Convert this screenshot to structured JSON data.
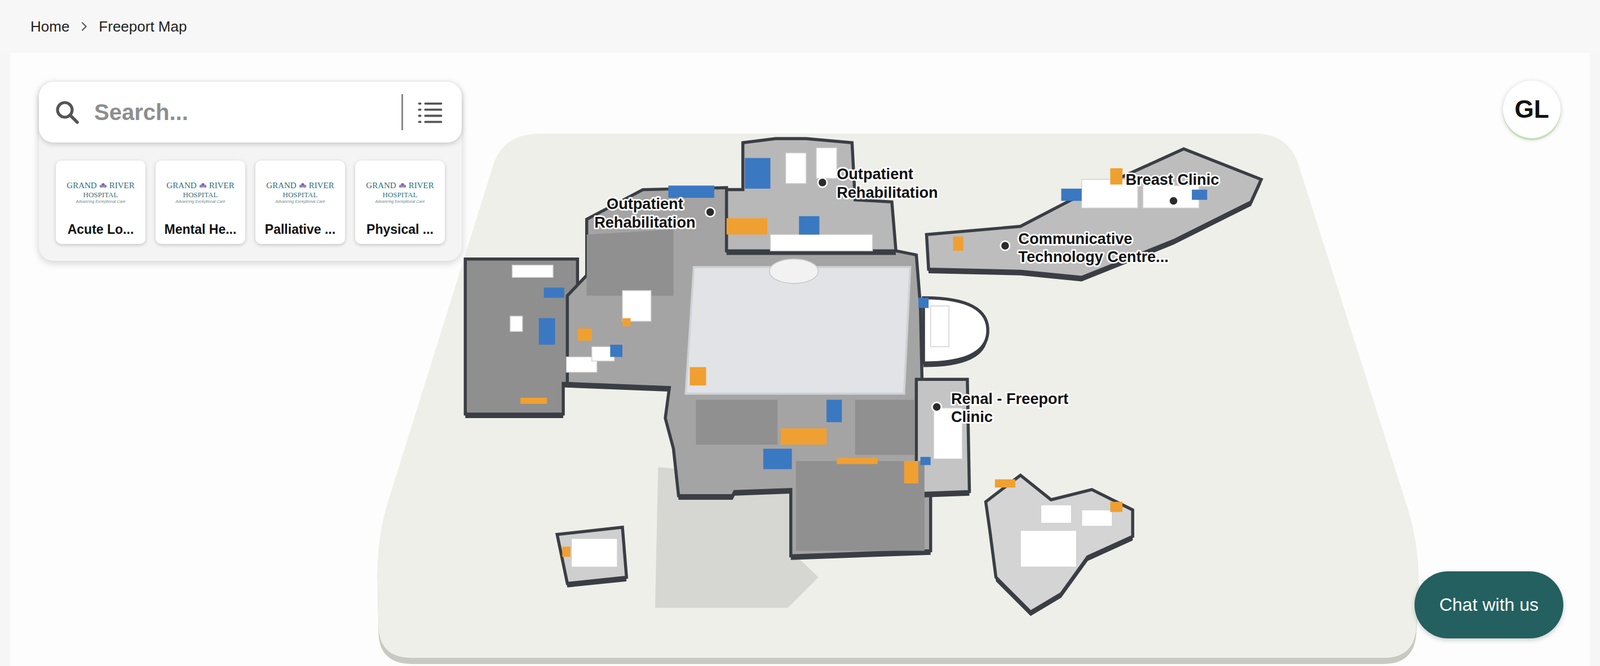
{
  "breadcrumb": {
    "items": [
      {
        "label": "Home"
      },
      {
        "label": "Freeport Map"
      }
    ]
  },
  "search": {
    "placeholder": "Search..."
  },
  "categories": [
    {
      "label": "Acute Lo...",
      "logo": {
        "left": "GRAND",
        "right": "RIVER",
        "sub": "HOSPITAL",
        "tagline": "Advancing Exceptional Care"
      }
    },
    {
      "label": "Mental He...",
      "logo": {
        "left": "GRAND",
        "right": "RIVER",
        "sub": "HOSPITAL",
        "tagline": "Advancing Exceptional Care"
      }
    },
    {
      "label": "Palliative ...",
      "logo": {
        "left": "GRAND",
        "right": "RIVER",
        "sub": "HOSPITAL",
        "tagline": "Advancing Exceptional Care"
      }
    },
    {
      "label": "Physical ...",
      "logo": {
        "left": "GRAND",
        "right": "RIVER",
        "sub": "HOSPITAL",
        "tagline": "Advancing Exceptional Care"
      }
    }
  ],
  "user": {
    "initials": "GL"
  },
  "map": {
    "labels": [
      {
        "lines": [
          "Outpatient",
          "Rehabilitation"
        ]
      },
      {
        "lines": [
          "Outpatient",
          "Rehabilitation"
        ]
      },
      {
        "lines": [
          "Breast Clinic"
        ]
      },
      {
        "lines": [
          "Communicative",
          "Technology Centre..."
        ]
      },
      {
        "lines": [
          "Renal - Freeport",
          "Clinic"
        ]
      }
    ]
  },
  "chat": {
    "label": "Chat with us"
  }
}
